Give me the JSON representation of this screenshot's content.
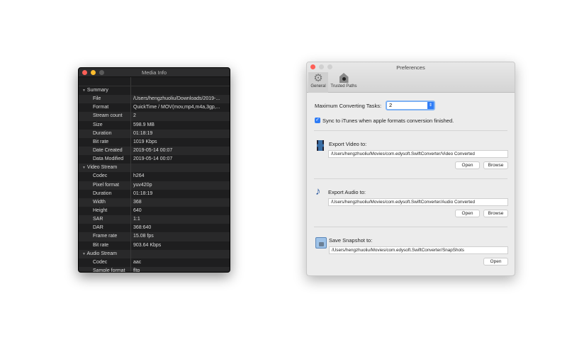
{
  "media_info": {
    "title": "Media Info",
    "rows": [
      {
        "k": "Summary",
        "v": "",
        "section": true
      },
      {
        "k": "File",
        "v": "/Users/hengzhuoliu/Downloads/2019-..."
      },
      {
        "k": "Format",
        "v": "QuickTime / MOV(mov,mp4,m4a,3gp,..."
      },
      {
        "k": "Stream count",
        "v": "2"
      },
      {
        "k": "Size",
        "v": "598.9 MB"
      },
      {
        "k": "Duration",
        "v": "01:18:19"
      },
      {
        "k": "Bit rate",
        "v": "1019 Kbps"
      },
      {
        "k": "Date Created",
        "v": "2019-05-14 00:07"
      },
      {
        "k": "Data Modified",
        "v": "2019-05-14 00:07"
      },
      {
        "k": "Video Stream",
        "v": "",
        "section": true
      },
      {
        "k": "Codec",
        "v": "h264"
      },
      {
        "k": "Pixel format",
        "v": "yuv420p"
      },
      {
        "k": "Duration",
        "v": "01:18:19"
      },
      {
        "k": "Width",
        "v": "368"
      },
      {
        "k": "Height",
        "v": "640"
      },
      {
        "k": "SAR",
        "v": "1:1"
      },
      {
        "k": "DAR",
        "v": "368:640"
      },
      {
        "k": "Frame rate",
        "v": "15.08 fps"
      },
      {
        "k": "Bit rate",
        "v": "903.64 Kbps"
      },
      {
        "k": "Audio Stream",
        "v": "",
        "section": true
      },
      {
        "k": "Codec",
        "v": "aac"
      },
      {
        "k": "Sample format",
        "v": "fltp"
      }
    ]
  },
  "preferences": {
    "title": "Preferences",
    "tabs": {
      "general": "General",
      "trusted": "Trusted Paths"
    },
    "max_tasks_label": "Maximum Converting Tasks:",
    "max_tasks_value": "2",
    "sync_label": "Sync to iTunes when apple formats conversion finished.",
    "sync_checked": true,
    "video": {
      "label": "Export Video to:",
      "path": "/Users/hengzhuoliu/Movies/com.edysoft.SwiftConverter/Video Converted"
    },
    "audio": {
      "label": "Export Audio to:",
      "path": "/Users/hengzhuoliu/Movies/com.edysoft.SwiftConverter/Audio Converted"
    },
    "snapshot": {
      "label": "Save Snapshot to:",
      "path": "/Users/hengzhuoliu/Movies/com.edysoft.SwiftConverter/SnapShots"
    },
    "open": "Open",
    "browse": "Browse"
  }
}
